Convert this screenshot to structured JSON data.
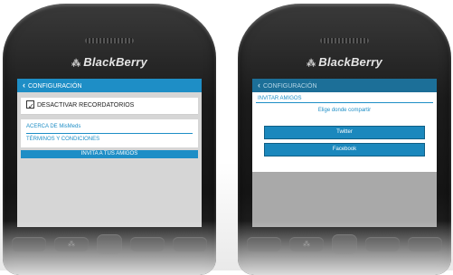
{
  "brand": {
    "logo_glyph": "⁂",
    "name": "BlackBerry"
  },
  "left_screen": {
    "title": "CONFIGURACIÓN",
    "back_icon": "‹",
    "toggle": {
      "label": "DESACTIVAR RECORDATORIOS",
      "checked": true,
      "check_glyph": "✓"
    },
    "links": [
      "ACERCA DE MisMeds",
      "TÉRMINOS Y CONDICIONES"
    ],
    "invite_button": "INVITA A TUS AMIGOS"
  },
  "right_screen": {
    "title": "CONFIGURACIÓN",
    "back_icon": "‹",
    "dialog": {
      "title": "INVITAR AMIGOS",
      "subtitle": "Elige donde compartir",
      "options": [
        "Twitter",
        "Facebook"
      ]
    }
  },
  "keys": {
    "menu_glyph": "⁂"
  },
  "colors": {
    "accent": "#1e8ec6",
    "screen_bg": "#d6d6d6",
    "device": "#1c1c1c"
  }
}
